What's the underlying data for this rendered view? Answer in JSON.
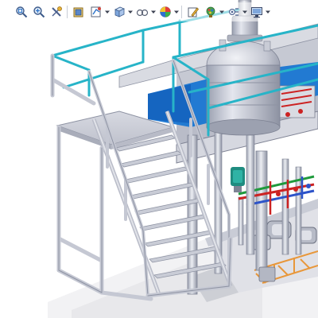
{
  "toolbar": {
    "items": [
      {
        "icon": "zoom-to-fit-icon",
        "has_dropdown": false
      },
      {
        "icon": "zoom-to-area-icon",
        "has_dropdown": false
      },
      {
        "icon": "previous-view-icon",
        "has_dropdown": false
      },
      {
        "icon": "section-view-icon",
        "has_dropdown": false
      },
      {
        "icon": "dynamic-annotation-icon",
        "has_dropdown": true
      },
      {
        "icon": "view-orientation-icon",
        "has_dropdown": true
      },
      {
        "icon": "display-style-icon",
        "has_dropdown": true
      },
      {
        "icon": "hide-show-items-icon",
        "has_dropdown": true
      },
      {
        "icon": "edit-appearance-icon",
        "has_dropdown": false
      },
      {
        "icon": "apply-scene-icon",
        "has_dropdown": true
      },
      {
        "icon": "view-settings-icon",
        "has_dropdown": true
      },
      {
        "icon": "monitor-icon",
        "has_dropdown": true
      }
    ]
  },
  "colors": {
    "railing": "#27b4c8",
    "frame": "#c9ccd6",
    "frame_shadow": "#7f8394",
    "tank_water": "#1976d2",
    "vessel": "#c3c6d1",
    "pump": "#1f8c80",
    "pipe_green": "#1f9a3c",
    "pipe_red": "#cc2222",
    "pipe_blue": "#2c53c9",
    "grid_orange": "#e8973a",
    "ground": "#e5e5e9",
    "background": "#ffffff"
  }
}
